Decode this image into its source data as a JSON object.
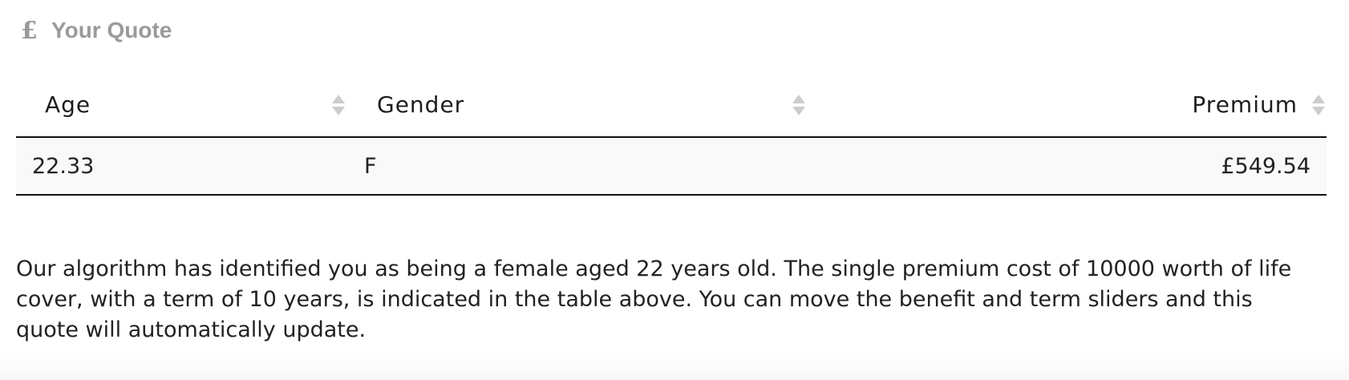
{
  "quote": {
    "currency_symbol": "£",
    "title": "Your Quote"
  },
  "table": {
    "columns": [
      {
        "label": "Age"
      },
      {
        "label": "Gender"
      },
      {
        "label": "Premium"
      }
    ],
    "rows": [
      {
        "age": "22.33",
        "gender": "F",
        "premium": "£549.54"
      }
    ]
  },
  "description": "Our algorithm has identified you as being a female aged 22 years old. The single premium cost of 10000 worth of life cover, with a term of 10 years, is indicated in the table above. You can move the benefit and term sliders and this quote will automatically update.",
  "colors": {
    "heading": "#9a9a9a",
    "row_background": "#f9f9f9",
    "rule": "#111111",
    "sort_icon": "#cccccc"
  },
  "icons": {
    "heading_icon": "pound-sign-icon",
    "sort_icon": "sort-arrows-icon"
  }
}
